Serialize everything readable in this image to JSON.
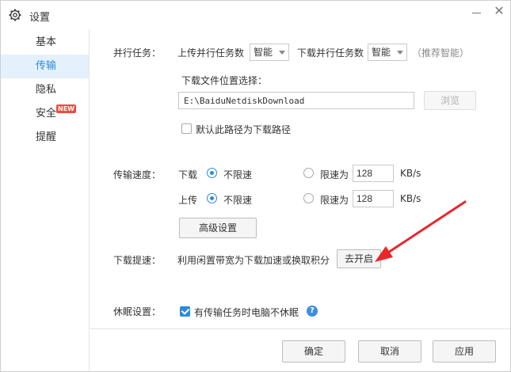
{
  "window": {
    "title": "设置"
  },
  "sidebar": {
    "items": [
      {
        "label": "基本"
      },
      {
        "label": "传输"
      },
      {
        "label": "隐私"
      },
      {
        "label": "安全",
        "badge": "NEW"
      },
      {
        "label": "提醒"
      }
    ],
    "active": "传输"
  },
  "parallel": {
    "section_label": "并行任务：",
    "upload_label": "上传并行任务数",
    "upload_value": "智能",
    "download_label": "下载并行任务数",
    "download_value": "智能",
    "hint": "（推荐智能）"
  },
  "location": {
    "title": "下载文件位置选择：",
    "path": "E:\\BaiduNetdiskDownload",
    "browse_label": "浏览",
    "default_checkbox_label": "默认此路径为下载路径",
    "default_checked": false
  },
  "speed": {
    "section_label": "传输速度：",
    "download": {
      "label": "下载",
      "unlimited_label": "不限速",
      "limit_label": "限速为",
      "value": "128",
      "unit": "KB/s",
      "selected": "unlimited"
    },
    "upload": {
      "label": "上传",
      "unlimited_label": "不限速",
      "limit_label": "限速为",
      "value": "128",
      "unit": "KB/s",
      "selected": "unlimited"
    },
    "advanced_label": "高级设置"
  },
  "boost": {
    "section_label": "下载提速：",
    "description": "利用闲置带宽为下载加速或换取积分",
    "button_label": "去开启"
  },
  "sleep": {
    "section_label": "休眠设置：",
    "checkbox_label": "有传输任务时电脑不休眠",
    "checked": true
  },
  "footer": {
    "ok_label": "确定",
    "cancel_label": "取消",
    "apply_label": "应用"
  },
  "colors": {
    "accent": "#2a8bd8",
    "arrow": "#e8262d",
    "badge": "#f04b3d"
  }
}
